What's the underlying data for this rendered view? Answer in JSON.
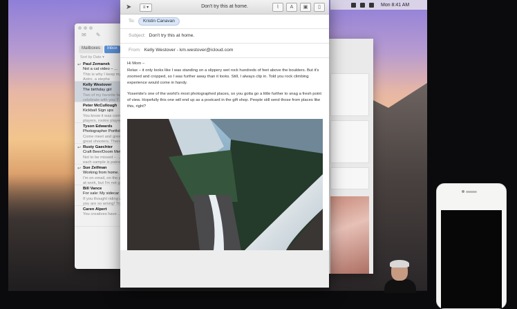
{
  "menubar": {
    "clock": "Mon 8:41 AM"
  },
  "sidebar": {
    "tabs": [
      "Mailboxes",
      "Inbox"
    ],
    "sort_label": "Sort by Date ▾",
    "items": [
      {
        "from": "Paul Zemanek",
        "subject": "Not a cat video – ...",
        "preview1": "This is why I keep my",
        "preview2": "Astro, a stephe",
        "flag": "↩",
        "selected": false
      },
      {
        "from": "Kelly Westover",
        "subject": "The birthday girl",
        "preview1": "Two of my favorite fac",
        "preview2": "celebrate with you T",
        "flag": "",
        "selected": true
      },
      {
        "from": "Peter McCullough",
        "subject": "Kickball Sign ups",
        "preview1": "You know it was comp",
        "preview2": "players, rookie player",
        "flag": "",
        "selected": false
      },
      {
        "from": "Tyson Edwards",
        "subject": "Photographer Portfolio",
        "preview1": "Come meet and greet",
        "preview2": "great shooters. There",
        "flag": "",
        "selected": false
      },
      {
        "from": "Rusty Gaechter",
        "subject": "Craft Beer/Doom Metal",
        "preview1": "Not to be missed – ...",
        "preview2": "each sample is paired",
        "flag": "↩",
        "selected": false
      },
      {
        "from": "Sue Zeifman",
        "subject": "Working from home.",
        "preview1": "I'm on email, on the p",
        "preview2": "at work, but I'm not go",
        "flag": "↩",
        "selected": false
      },
      {
        "from": "Bill Vance",
        "subject": "For sale: My sidecar m",
        "preview1": "If you thought riding w",
        "preview2": "you are so wrong! Try",
        "flag": "",
        "selected": false
      },
      {
        "from": "Caren Alpert",
        "subject": "",
        "preview1": "You creatives have ..",
        "preview2": "",
        "flag": "",
        "selected": false
      }
    ]
  },
  "compose": {
    "title": "Don't try this at home.",
    "to_label": "To:",
    "to_chip": "Kristin Canavan",
    "subject_label": "Subject:",
    "subject": "Don't try this at home.",
    "from_label": "From:",
    "from": "Kelly Westover - km.westover@icloud.com",
    "greeting": "Hi Mom –",
    "para1": "Relax – it only looks like I was standing on a slippery wet rock hundreds of feet above the boulders. But it's zoomed and cropped, so I was further away than it looks. Still, I always clip in. Told you rock climbing experience would come in handy.",
    "para2": "Yosemite's one of the world's most photographed places, so you gotta go a little further to snag a fresh point of view. Hopefully this one will end up as a postcard in the gift shop. People still send those from places like this, right?"
  }
}
